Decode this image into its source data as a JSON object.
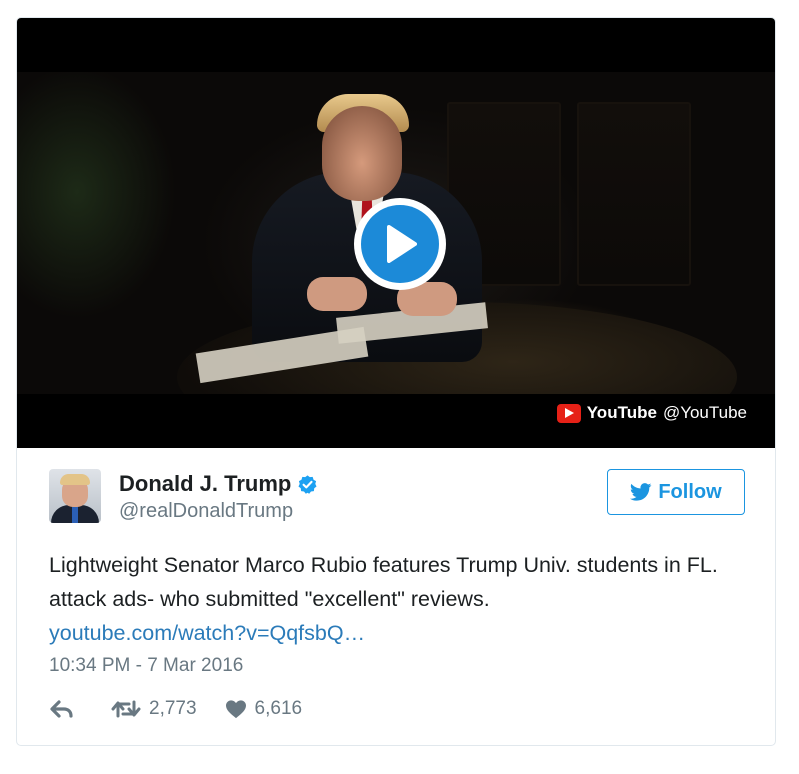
{
  "video": {
    "attribution_source": "YouTube",
    "attribution_handle": "@YouTube"
  },
  "user": {
    "display_name": "Donald J. Trump",
    "handle": "@realDonaldTrump"
  },
  "follow_label": "Follow",
  "tweet": {
    "text": "Lightweight Senator Marco Rubio features Trump Univ. students in FL. attack ads- who submitted \"excellent\" reviews.",
    "link": "youtube.com/watch?v=QqfsbQ…",
    "timestamp": "10:34 PM - 7 Mar 2016"
  },
  "stats": {
    "retweets": "2,773",
    "likes": "6,616"
  },
  "colors": {
    "accent": "#1b95e0",
    "link": "#2b7bb9",
    "muted": "#697882",
    "play_button": "#1c8ad8",
    "youtube_red": "#e62117"
  }
}
